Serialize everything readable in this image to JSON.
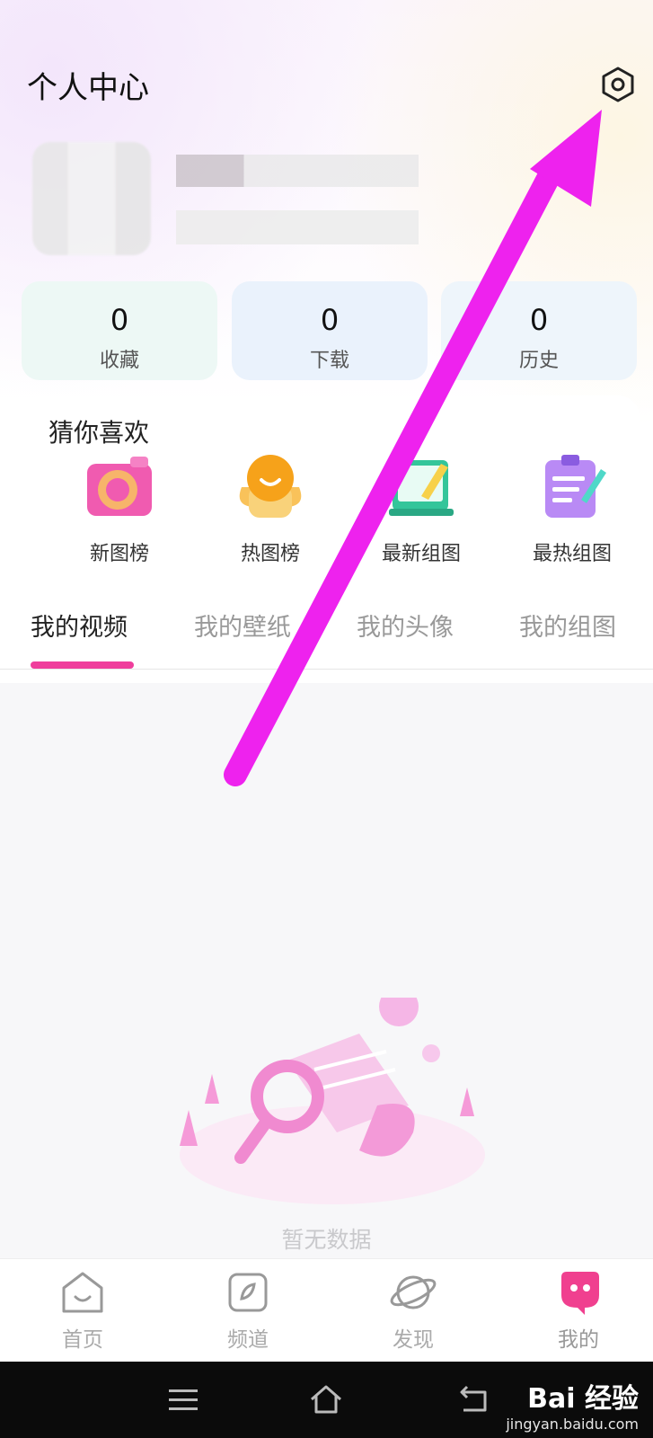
{
  "header": {
    "title": "个人中心"
  },
  "stats": [
    {
      "value": "0",
      "label": "收藏"
    },
    {
      "value": "0",
      "label": "下载"
    },
    {
      "value": "0",
      "label": "历史"
    }
  ],
  "recommend": {
    "title": "猜你喜欢",
    "items": [
      {
        "label": "新图榜",
        "icon": "camera-icon"
      },
      {
        "label": "热图榜",
        "icon": "smile-face-icon"
      },
      {
        "label": "最新组图",
        "icon": "picture-frame-icon"
      },
      {
        "label": "最热组图",
        "icon": "clipboard-pen-icon"
      }
    ]
  },
  "tabs": [
    {
      "label": "我的视频",
      "active": true
    },
    {
      "label": "我的壁纸",
      "active": false
    },
    {
      "label": "我的头像",
      "active": false
    },
    {
      "label": "我的组图",
      "active": false
    }
  ],
  "empty": {
    "text": "暂无数据"
  },
  "bottom_nav": [
    {
      "label": "首页",
      "icon": "home-icon"
    },
    {
      "label": "频道",
      "icon": "channel-icon"
    },
    {
      "label": "发现",
      "icon": "planet-icon"
    },
    {
      "label": "我的",
      "icon": "mascot-icon",
      "active": true
    }
  ],
  "watermark": {
    "brand": "Bai 经验",
    "url": "jingyan.baidu.com"
  },
  "colors": {
    "accent": "#ef3e9c",
    "arrow": "#ee22ee"
  }
}
